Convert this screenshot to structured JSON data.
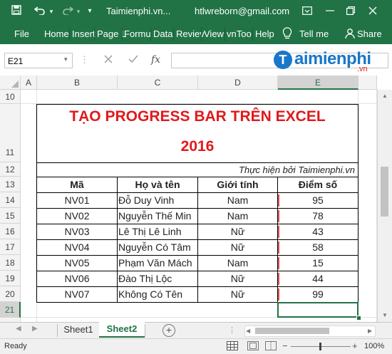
{
  "titlebar": {
    "filename": "Taimienphi.vn...",
    "account": "htlwreborn@gmail.com"
  },
  "ribbon": {
    "tabs": [
      "File",
      "Home",
      "Insert",
      "Page L",
      "Formu",
      "Data",
      "Reviev",
      "View",
      "vnToo",
      "Help"
    ],
    "tell_me": "Tell me",
    "share": "Share"
  },
  "formula_bar": {
    "name_box": "E21",
    "fx": "fx",
    "formula": ""
  },
  "watermark": {
    "brand": "aimienphi",
    "suffix": ".vn"
  },
  "columns": [
    "A",
    "B",
    "C",
    "D",
    "E"
  ],
  "rows": [
    "10",
    "11",
    "12",
    "13",
    "14",
    "15",
    "16",
    "17",
    "18",
    "19",
    "20",
    "21"
  ],
  "table": {
    "title_line1": "TẠO PROGRESS BAR TRÊN EXCEL",
    "title_line2": "2016",
    "credit": "Thực hiện bởi Taimienphi.vn",
    "headers": [
      "Mã",
      "Họ và tên",
      "Giới tính",
      "Điểm số"
    ],
    "rows": [
      [
        "NV01",
        "Đỗ Duy Vinh",
        "Nam",
        "95"
      ],
      [
        "NV02",
        "Nguyễn Thế Min",
        "Nam",
        "78"
      ],
      [
        "NV03",
        "Lê Thị Lê Linh",
        "Nữ",
        "43"
      ],
      [
        "NV04",
        "Nguyễn Có  Tâm",
        "Nữ",
        "58"
      ],
      [
        "NV05",
        "Phạm Văn Mách",
        "Nam",
        "15"
      ],
      [
        "NV06",
        "Đào Thị Lộc",
        "Nữ",
        "44"
      ],
      [
        "NV07",
        "Không Có Tên",
        "Nữ",
        "99"
      ]
    ]
  },
  "sheets": {
    "tabs": [
      "Sheet1",
      "Sheet2"
    ],
    "active": "Sheet2"
  },
  "status": {
    "state": "Ready",
    "zoom": "100%"
  },
  "colors": {
    "excel_green": "#217346",
    "title_red": "#e0191c",
    "selection": "#217346"
  }
}
